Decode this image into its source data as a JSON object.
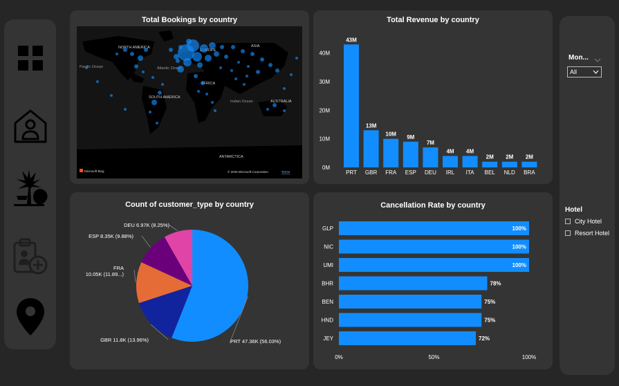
{
  "nav": {
    "items": [
      {
        "name": "dashboard",
        "icon": "grid-icon"
      },
      {
        "name": "home-guest",
        "icon": "home-person-icon"
      },
      {
        "name": "resort",
        "icon": "palm-tree-icon"
      },
      {
        "name": "booking-add",
        "icon": "clipboard-add-person-icon"
      },
      {
        "name": "location",
        "icon": "map-pin-icon"
      }
    ]
  },
  "bookings_map": {
    "title": "Total Bookings by country",
    "labels": {
      "north_america": "NORTH AMERICA",
      "europe": "EUROPE",
      "asia": "ASIA",
      "pacific_ocean": "Pacific Ocean",
      "atlantic_ocean": "Atlantic Ocean",
      "africa": "AFRICA",
      "south_america": "SOUTH AMERICA",
      "indian_ocean": "Indian Ocean",
      "australia": "AUSTRALIA",
      "antarctica": "ANTARCTICA"
    },
    "attribution": {
      "brand": "Microsoft Bing",
      "copyright": "© 2025 Microsoft Corporation",
      "terms": "Terms"
    }
  },
  "revenue_chart": {
    "title": "Total Revenue by country",
    "chart_data": {
      "type": "bar",
      "categories": [
        "PRT",
        "GBR",
        "FRA",
        "ESP",
        "DEU",
        "IRL",
        "ITA",
        "BEL",
        "NLD",
        "BRA"
      ],
      "values": [
        43,
        13,
        10,
        9,
        7,
        4,
        4,
        2,
        2,
        2
      ],
      "data_labels": [
        "43M",
        "13M",
        "10M",
        "9M",
        "7M",
        "4M",
        "4M",
        "2M",
        "2M",
        "2M"
      ],
      "y_ticks": [
        "0M",
        "10M",
        "20M",
        "30M",
        "40M"
      ],
      "y_tick_values": [
        0,
        10,
        20,
        30,
        40
      ],
      "ylim": [
        0,
        45
      ],
      "grid": false,
      "color": "#118DFF"
    }
  },
  "customer_pie": {
    "title": "Count of customer_type by country",
    "chart_data": {
      "type": "pie",
      "slices": [
        {
          "label": "PRT",
          "value": 47.36,
          "text": "PRT 47.36K (56.03%)",
          "color": "#118DFF"
        },
        {
          "label": "GBR",
          "value": 11.8,
          "text": "GBR 11.8K (13.96%)",
          "color": "#12239E"
        },
        {
          "label": "FRA",
          "value": 10.05,
          "text": "FRA",
          "text2": "10.05K (11.89...)",
          "color": "#E66C37"
        },
        {
          "label": "ESP",
          "value": 8.35,
          "text": "ESP 8.35K (9.88%)",
          "color": "#6B007B"
        },
        {
          "label": "DEU",
          "value": 6.97,
          "text": "DEU 6.97K (8.25%)",
          "color": "#E044A7"
        }
      ]
    }
  },
  "cancel_chart": {
    "title": "Cancellation Rate by country",
    "chart_data": {
      "type": "bar",
      "orientation": "horizontal",
      "categories": [
        "GLP",
        "NIC",
        "UMI",
        "BHR",
        "BEN",
        "HND",
        "JEY"
      ],
      "values": [
        100,
        100,
        100,
        78,
        75,
        75,
        72
      ],
      "data_labels": [
        "100%",
        "100%",
        "100%",
        "78%",
        "75%",
        "75%",
        "72%"
      ],
      "x_ticks": [
        "0%",
        "50%",
        "100%"
      ],
      "x_tick_values": [
        0,
        50,
        100
      ],
      "xlim": [
        0,
        100
      ],
      "color": "#118DFF"
    }
  },
  "slicers": {
    "month_label": "Mon...",
    "month_value": "All",
    "hotel_label": "Hotel",
    "hotel_options": [
      "City Hotel",
      "Resort Hotel"
    ]
  }
}
